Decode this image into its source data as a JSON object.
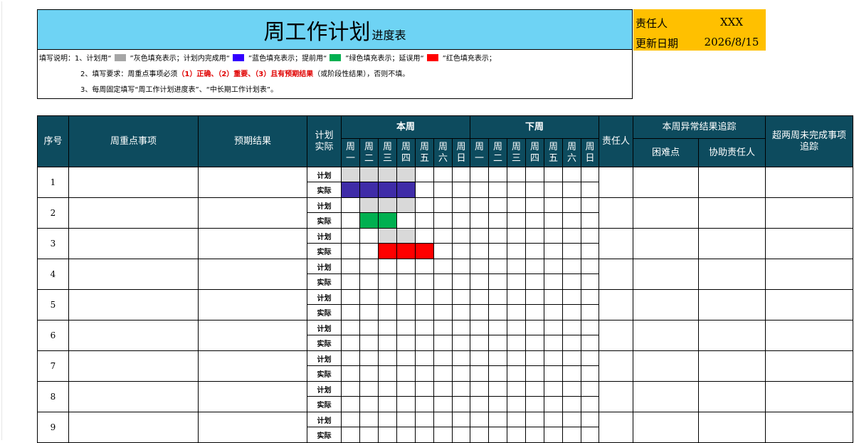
{
  "title": {
    "main": "周工作计划",
    "sub": "进度表"
  },
  "meta": {
    "owner_label": "责任人",
    "owner_value": "XXX",
    "date_label": "更新日期",
    "date_value": "2026/8/15"
  },
  "colors": {
    "header_bg": "#0d4b5e",
    "title_bg": "#6ed3f4",
    "meta_bg": "#ffc000",
    "gray": "#d9d9d9",
    "blue": "#3f2ca8",
    "green": "#00b050",
    "red": "#ff0000"
  },
  "notes": {
    "l1_a": "填写说明：1、计划用“",
    "l1_b": "”灰色填充表示；计划内完成用“",
    "l1_c": "”蓝色填充表示；提前用“",
    "l1_d": "”绿色填充表示；延误用“",
    "l1_e": "”红色填充表示；",
    "l2_a": "2、填写要求：周重点事项必须",
    "l2_b": "（1）正确、（2）重要、（3）且有预期结果",
    "l2_c": "（或阶段性结果），否则不填。",
    "l3": "3、每周固定填写“周工作计划进度表”、“中长期工作计划表”。"
  },
  "headers": {
    "seq": "序号",
    "focus": "周重点事项",
    "expected": "预期结果",
    "plan_actual_1": "计划",
    "plan_actual_2": "实际",
    "this_week": "本周",
    "next_week": "下周",
    "owner": "责任人",
    "anomaly": "本周异常结果追踪",
    "difficulty": "困难点",
    "helper": "协助责任人",
    "overdue_1": "超两周未完成事项",
    "overdue_2": "追踪"
  },
  "days": [
    [
      "周",
      "一"
    ],
    [
      "周",
      "二"
    ],
    [
      "周",
      "三"
    ],
    [
      "周",
      "四"
    ],
    [
      "周",
      "五"
    ],
    [
      "周",
      "六"
    ],
    [
      "周",
      "日"
    ]
  ],
  "row_labels": {
    "plan": "计划",
    "actual": "实际"
  },
  "rows": [
    {
      "no": "1",
      "plan": [
        1,
        1,
        1,
        1,
        0,
        0,
        0,
        0,
        0,
        0,
        0,
        0,
        0,
        0
      ],
      "actual": [
        1,
        1,
        1,
        1,
        0,
        0,
        0,
        0,
        0,
        0,
        0,
        0,
        0,
        0
      ],
      "actual_color": "blue"
    },
    {
      "no": "2",
      "plan": [
        0,
        1,
        1,
        1,
        0,
        0,
        0,
        0,
        0,
        0,
        0,
        0,
        0,
        0
      ],
      "actual": [
        0,
        1,
        1,
        0,
        0,
        0,
        0,
        0,
        0,
        0,
        0,
        0,
        0,
        0
      ],
      "actual_color": "green"
    },
    {
      "no": "3",
      "plan": [
        0,
        0,
        1,
        1,
        0,
        0,
        0,
        0,
        0,
        0,
        0,
        0,
        0,
        0
      ],
      "actual": [
        0,
        0,
        1,
        1,
        1,
        0,
        0,
        0,
        0,
        0,
        0,
        0,
        0,
        0
      ],
      "actual_color": "red"
    },
    {
      "no": "4",
      "plan": [
        0,
        0,
        0,
        0,
        0,
        0,
        0,
        0,
        0,
        0,
        0,
        0,
        0,
        0
      ],
      "actual": [
        0,
        0,
        0,
        0,
        0,
        0,
        0,
        0,
        0,
        0,
        0,
        0,
        0,
        0
      ],
      "actual_color": ""
    },
    {
      "no": "5",
      "plan": [
        0,
        0,
        0,
        0,
        0,
        0,
        0,
        0,
        0,
        0,
        0,
        0,
        0,
        0
      ],
      "actual": [
        0,
        0,
        0,
        0,
        0,
        0,
        0,
        0,
        0,
        0,
        0,
        0,
        0,
        0
      ],
      "actual_color": ""
    },
    {
      "no": "6",
      "plan": [
        0,
        0,
        0,
        0,
        0,
        0,
        0,
        0,
        0,
        0,
        0,
        0,
        0,
        0
      ],
      "actual": [
        0,
        0,
        0,
        0,
        0,
        0,
        0,
        0,
        0,
        0,
        0,
        0,
        0,
        0
      ],
      "actual_color": ""
    },
    {
      "no": "7",
      "plan": [
        0,
        0,
        0,
        0,
        0,
        0,
        0,
        0,
        0,
        0,
        0,
        0,
        0,
        0
      ],
      "actual": [
        0,
        0,
        0,
        0,
        0,
        0,
        0,
        0,
        0,
        0,
        0,
        0,
        0,
        0
      ],
      "actual_color": ""
    },
    {
      "no": "8",
      "plan": [
        0,
        0,
        0,
        0,
        0,
        0,
        0,
        0,
        0,
        0,
        0,
        0,
        0,
        0
      ],
      "actual": [
        0,
        0,
        0,
        0,
        0,
        0,
        0,
        0,
        0,
        0,
        0,
        0,
        0,
        0
      ],
      "actual_color": ""
    },
    {
      "no": "9",
      "plan": [
        0,
        0,
        0,
        0,
        0,
        0,
        0,
        0,
        0,
        0,
        0,
        0,
        0,
        0
      ],
      "actual": [
        0,
        0,
        0,
        0,
        0,
        0,
        0,
        0,
        0,
        0,
        0,
        0,
        0,
        0
      ],
      "actual_color": ""
    }
  ]
}
